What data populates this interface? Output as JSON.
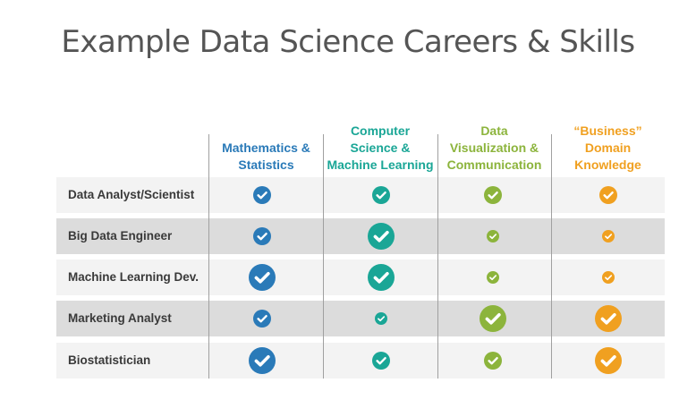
{
  "title": "Example Data Science Careers & Skills",
  "columns": [
    {
      "label": "Mathematics &\nStatistics",
      "color": "#2a7ab8"
    },
    {
      "label": "Computer\nScience &\nMachine Learning",
      "color": "#1aa696"
    },
    {
      "label": "Data\nVisualization &\nCommunication",
      "color": "#8cb43c"
    },
    {
      "label": "“Business”\nDomain\nKnowledge",
      "color": "#f0a020"
    }
  ],
  "rows": [
    {
      "label": "Data Analyst/Scientist",
      "shade": "#f3f3f3",
      "levels": [
        "medium",
        "medium",
        "medium",
        "medium"
      ]
    },
    {
      "label": "Big Data Engineer",
      "shade": "#dcdcdc",
      "levels": [
        "medium",
        "large",
        "small",
        "small"
      ]
    },
    {
      "label": "Machine Learning Dev.",
      "shade": "#f3f3f3",
      "levels": [
        "large",
        "large",
        "small",
        "small"
      ]
    },
    {
      "label": "Marketing Analyst",
      "shade": "#dcdcdc",
      "levels": [
        "medium",
        "small",
        "large",
        "large"
      ]
    },
    {
      "label": "Biostatistician",
      "shade": "#f3f3f3",
      "levels": [
        "large",
        "medium",
        "medium",
        "large"
      ]
    }
  ],
  "icons": {
    "check": "check-circle-icon"
  }
}
